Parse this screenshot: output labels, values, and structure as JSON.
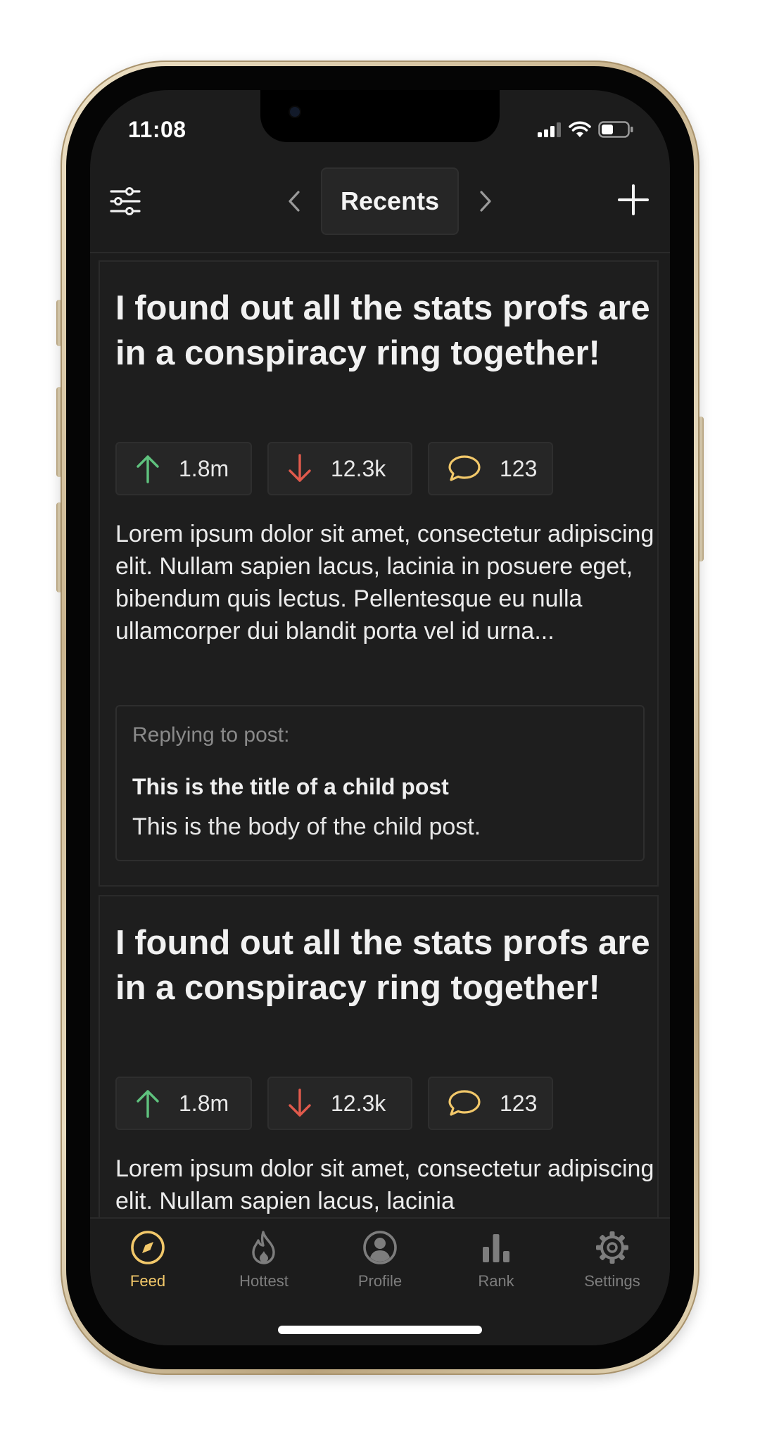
{
  "status_bar": {
    "time": "11:08"
  },
  "header": {
    "current_tab_label": "Recents"
  },
  "posts": [
    {
      "title": "I found out all the stats profs are in a conspiracy ring together!",
      "upvotes": "1.8m",
      "downvotes": "12.3k",
      "comments": "123",
      "body": "Lorem ipsum dolor sit amet, consectetur adipiscing elit. Nullam sapien lacus, lacinia in posuere eget, bibendum quis lectus. Pellentesque eu nulla ullamcorper dui blandit porta vel id urna...",
      "reply": {
        "label": "Replying to post:",
        "title": "This is the title of a child post",
        "body": "This is the body of the child post."
      }
    },
    {
      "title": "I found out all the stats profs are in a conspiracy ring together!",
      "upvotes": "1.8m",
      "downvotes": "12.3k",
      "comments": "123",
      "body": "Lorem ipsum dolor sit amet, consectetur adipiscing elit. Nullam sapien lacus, lacinia"
    }
  ],
  "tab_bar": {
    "items": [
      {
        "label": "Feed",
        "icon": "compass-icon",
        "active": true
      },
      {
        "label": "Hottest",
        "icon": "flame-icon",
        "active": false
      },
      {
        "label": "Profile",
        "icon": "user-circle-icon",
        "active": false
      },
      {
        "label": "Rank",
        "icon": "bar-chart-icon",
        "active": false
      },
      {
        "label": "Settings",
        "icon": "gear-icon",
        "active": false
      }
    ]
  },
  "colors": {
    "accent": "#f2c86a",
    "upvote": "#5fc27e",
    "downvote": "#e05a4c",
    "comment": "#f2c86a",
    "background": "#1c1c1c"
  }
}
